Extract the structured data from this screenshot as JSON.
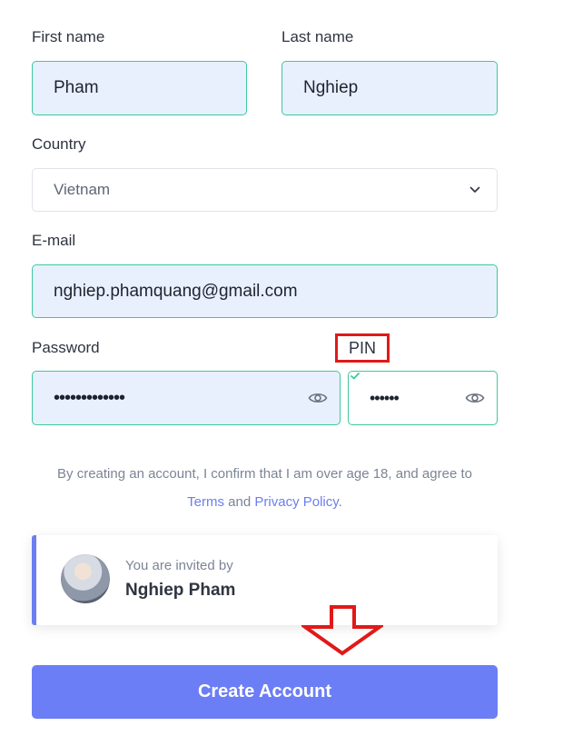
{
  "form": {
    "first_name_label": "First name",
    "first_name_value": "Pham",
    "last_name_label": "Last name",
    "last_name_value": "Nghiep",
    "country_label": "Country",
    "country_value": "Vietnam",
    "email_label": "E-mail",
    "email_value": "nghiep.phamquang@gmail.com",
    "password_label": "Password",
    "password_mask": "•••••••••••••",
    "pin_label": "PIN",
    "pin_mask": "••••••"
  },
  "notice": {
    "line1": "By creating an account, I confirm that I am over age 18, and agree to",
    "terms_link": "Terms",
    "and_text": " and ",
    "privacy_link": "Privacy Policy",
    "period": "."
  },
  "invite": {
    "caption": "You are invited by",
    "name": "Nghiep Pham"
  },
  "create_button_label": "Create Account",
  "colors": {
    "accent": "#6c7ef5",
    "valid_border": "#3cc99b",
    "annotation_red": "#e01919"
  }
}
